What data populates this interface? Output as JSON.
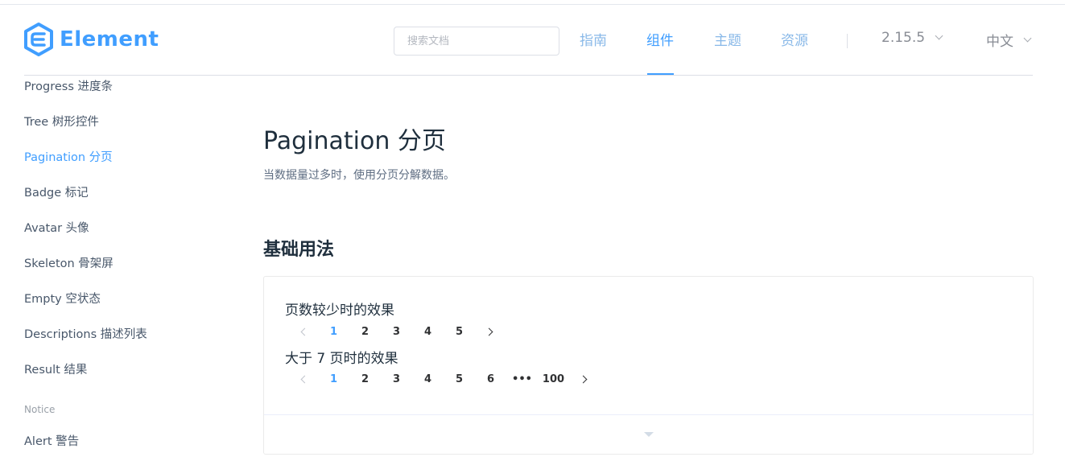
{
  "header": {
    "logo_text": "Element",
    "search_placeholder": "搜索文档",
    "nav": [
      {
        "label": "指南"
      },
      {
        "label": "组件"
      },
      {
        "label": "主题"
      },
      {
        "label": "资源"
      }
    ],
    "version": "2.15.5",
    "language": "中文",
    "accent_color": "#409eff"
  },
  "sidebar": {
    "items": [
      {
        "label": "Progress 进度条"
      },
      {
        "label": "Tree 树形控件"
      },
      {
        "label": "Pagination 分页"
      },
      {
        "label": "Badge 标记"
      },
      {
        "label": "Avatar 头像"
      },
      {
        "label": "Skeleton 骨架屏"
      },
      {
        "label": "Empty 空状态"
      },
      {
        "label": "Descriptions 描述列表"
      },
      {
        "label": "Result 结果"
      }
    ],
    "group_notice": "Notice",
    "notice_items": [
      {
        "label": "Alert 警告"
      }
    ]
  },
  "main": {
    "title": "Pagination 分页",
    "description": "当数据量过多时，使用分页分解数据。",
    "section_title": "基础用法",
    "demo": {
      "label_few": "页数较少时的效果",
      "pager_few": [
        "1",
        "2",
        "3",
        "4",
        "5"
      ],
      "label_many": "大于 7 页时的效果",
      "pager_many": [
        "1",
        "2",
        "3",
        "4",
        "5",
        "6",
        "•••",
        "100"
      ],
      "current_page": "1"
    }
  }
}
